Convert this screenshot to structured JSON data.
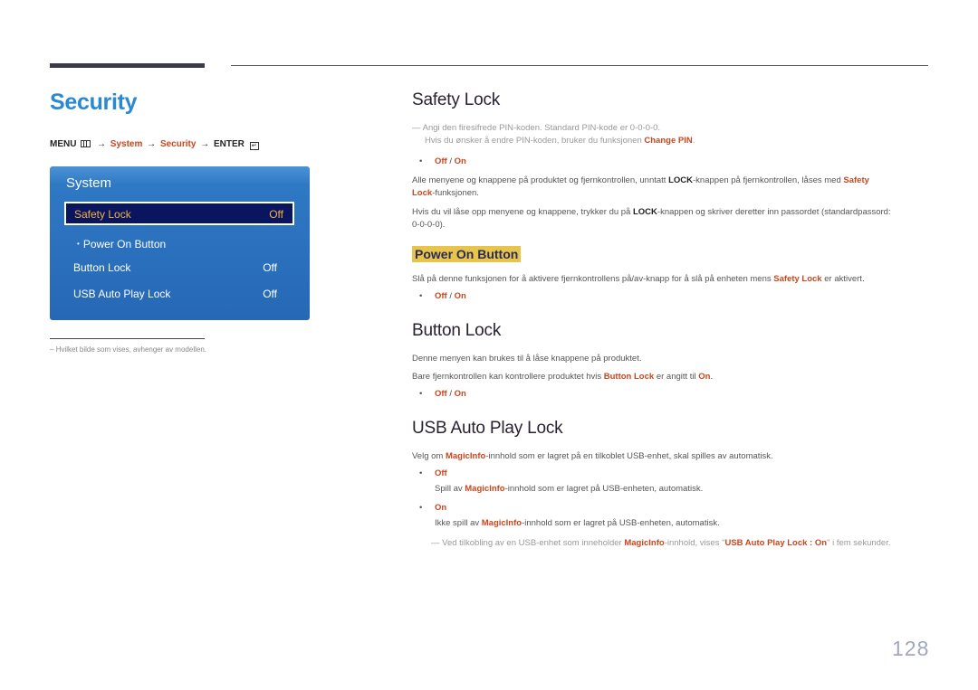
{
  "page": {
    "title": "Security",
    "number": "128"
  },
  "menu_path": {
    "menu": "MENU",
    "menu_icon": "menu-grid-icon",
    "arrow": "→",
    "system": "System",
    "security": "Security",
    "enter": "ENTER",
    "enter_icon": "enter-icon"
  },
  "osd": {
    "title": "System",
    "selected": {
      "label": "Safety Lock",
      "value": "Off"
    },
    "sub_item": {
      "bullet": "•",
      "label": "Power On Button"
    },
    "items": [
      {
        "label": "Button Lock",
        "value": "Off"
      },
      {
        "label": "USB Auto Play Lock",
        "value": "Off"
      }
    ],
    "colors": {
      "panel": "#2668b6",
      "selected_bg": "#0a1560",
      "selected_text": "#f2b33d"
    }
  },
  "footnote": {
    "dash": "–",
    "text": "Hvilket bilde som vises, avhenger av modellen."
  },
  "sections": {
    "safety_lock": {
      "title": "Safety Lock",
      "note_line1": "Angi den firesifrede PIN-koden. Standard PIN-kode er 0-0-0-0.",
      "note_line2_pre": "Hvis du ønsker å endre PIN-koden, bruker du funksjonen ",
      "note_line2_hl": "Change PIN",
      "note_line2_post": ".",
      "option_off": "Off",
      "option_sep": " / ",
      "option_on": "On",
      "para1_a": "Alle menyene og knappene på produktet og fjernkontrollen, unntatt ",
      "para1_b": "LOCK",
      "para1_c": "-knappen på fjernkontrollen, låses med ",
      "para1_d": "Safety",
      "para1_e": "Lock",
      "para1_f": "-funksjonen.",
      "para2_a": "Hvis du vil låse opp menyene og knappene, trykker du på ",
      "para2_b": "LOCK",
      "para2_c": "-knappen og skriver deretter inn passordet (standardpassord:",
      "para2_d": "0-0-0-0)."
    },
    "power_on_button": {
      "title": "Power On Button",
      "para_a": "Slå på denne funksjonen for å aktivere fjernkontrollens på/av-knapp for å slå på enheten mens ",
      "para_b": "Safety Lock",
      "para_c": " er aktivert.",
      "option_off": "Off",
      "option_sep": " / ",
      "option_on": "On"
    },
    "button_lock": {
      "title": "Button Lock",
      "para1": "Denne menyen kan brukes til å låse knappene på produktet.",
      "para2_a": "Bare fjernkontrollen kan kontrollere produktet hvis ",
      "para2_b": "Button Lock",
      "para2_c": " er angitt til ",
      "para2_d": "On",
      "para2_e": ".",
      "option_off": "Off",
      "option_sep": " / ",
      "option_on": "On"
    },
    "usb_auto_play_lock": {
      "title": "USB Auto Play Lock",
      "para_a": "Velg om ",
      "para_b": "MagicInfo",
      "para_c": "-innhold som er lagret på en tilkoblet USB-enhet, skal spilles av automatisk.",
      "off_label": "Off",
      "off_desc_a": "Spill av ",
      "off_desc_b": "MagicInfo",
      "off_desc_c": "-innhold som er lagret på USB-enheten, automatisk.",
      "on_label": "On",
      "on_desc_a": "Ikke spill av ",
      "on_desc_b": "MagicInfo",
      "on_desc_c": "-innhold som er lagret på USB-enheten, automatisk.",
      "note_a": "Ved tilkobling av en USB-enhet som inneholder ",
      "note_b": "MagicInfo",
      "note_c": "-innhold, vises \"",
      "note_d": "USB Auto Play Lock : On",
      "note_e": "\" i fem sekunder."
    }
  },
  "bullet": "•",
  "note_dash": "—",
  "colors": {
    "accent": "#2a8ad1",
    "highlight": "#c8461e",
    "subheading_bg": "#e7c44a"
  }
}
